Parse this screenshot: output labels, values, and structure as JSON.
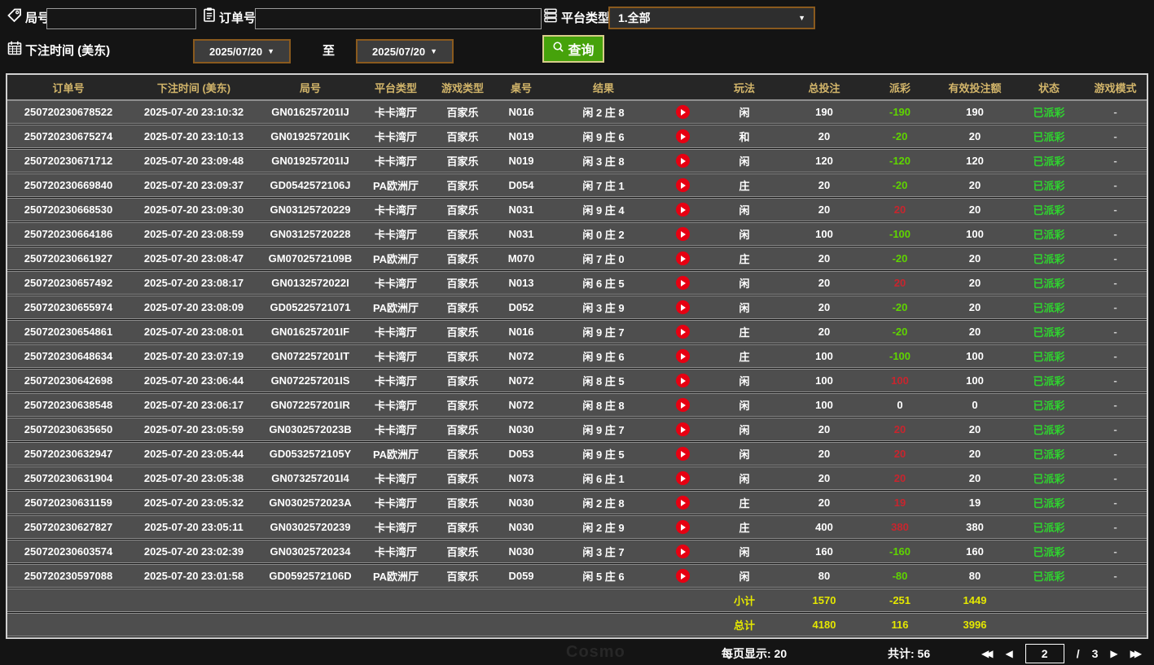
{
  "filter_bar": {
    "game_no_label": "局号",
    "game_no_value": "",
    "order_no_label": "订单号",
    "order_no_value": "",
    "platform_label": "平台类型",
    "platform_value": "1.全部",
    "bet_time_label": "下注时间 (美东)",
    "date_from": "2025/07/20",
    "range_to_label": "至",
    "date_to": "2025/07/20",
    "search_label": "查询"
  },
  "table": {
    "headers": [
      "订单号",
      "下注时间 (美东)",
      "局号",
      "平台类型",
      "游戏类型",
      "桌号",
      "结果",
      "",
      "玩法",
      "总投注",
      "派彩",
      "有效投注额",
      "状态",
      "游戏模式"
    ],
    "rows": [
      {
        "order_id": "250720230678522",
        "bet_time": "2025-07-20 23:10:32",
        "game_id": "GN016257201IJ",
        "platform": "卡卡湾厅",
        "game_type": "百家乐",
        "table_no": "N016",
        "result": "闲 2 庄 8",
        "play": "闲",
        "total_bet": "190",
        "payout": "-190",
        "valid_bet": "190",
        "status": "已派彩",
        "mode": "-"
      },
      {
        "order_id": "250720230675274",
        "bet_time": "2025-07-20 23:10:13",
        "game_id": "GN019257201IK",
        "platform": "卡卡湾厅",
        "game_type": "百家乐",
        "table_no": "N019",
        "result": "闲 9 庄 6",
        "play": "和",
        "total_bet": "20",
        "payout": "-20",
        "valid_bet": "20",
        "status": "已派彩",
        "mode": "-"
      },
      {
        "order_id": "250720230671712",
        "bet_time": "2025-07-20 23:09:48",
        "game_id": "GN019257201IJ",
        "platform": "卡卡湾厅",
        "game_type": "百家乐",
        "table_no": "N019",
        "result": "闲 3 庄 8",
        "play": "闲",
        "total_bet": "120",
        "payout": "-120",
        "valid_bet": "120",
        "status": "已派彩",
        "mode": "-"
      },
      {
        "order_id": "250720230669840",
        "bet_time": "2025-07-20 23:09:37",
        "game_id": "GD0542572106J",
        "platform": "PA欧洲厅",
        "game_type": "百家乐",
        "table_no": "D054",
        "result": "闲 7 庄 1",
        "play": "庄",
        "total_bet": "20",
        "payout": "-20",
        "valid_bet": "20",
        "status": "已派彩",
        "mode": "-"
      },
      {
        "order_id": "250720230668530",
        "bet_time": "2025-07-20 23:09:30",
        "game_id": "GN03125720229",
        "platform": "卡卡湾厅",
        "game_type": "百家乐",
        "table_no": "N031",
        "result": "闲 9 庄 4",
        "play": "闲",
        "total_bet": "20",
        "payout": "20",
        "valid_bet": "20",
        "status": "已派彩",
        "mode": "-"
      },
      {
        "order_id": "250720230664186",
        "bet_time": "2025-07-20 23:08:59",
        "game_id": "GN03125720228",
        "platform": "卡卡湾厅",
        "game_type": "百家乐",
        "table_no": "N031",
        "result": "闲 0 庄 2",
        "play": "闲",
        "total_bet": "100",
        "payout": "-100",
        "valid_bet": "100",
        "status": "已派彩",
        "mode": "-"
      },
      {
        "order_id": "250720230661927",
        "bet_time": "2025-07-20 23:08:47",
        "game_id": "GM0702572109B",
        "platform": "PA欧洲厅",
        "game_type": "百家乐",
        "table_no": "M070",
        "result": "闲 7 庄 0",
        "play": "庄",
        "total_bet": "20",
        "payout": "-20",
        "valid_bet": "20",
        "status": "已派彩",
        "mode": "-"
      },
      {
        "order_id": "250720230657492",
        "bet_time": "2025-07-20 23:08:17",
        "game_id": "GN0132572022I",
        "platform": "卡卡湾厅",
        "game_type": "百家乐",
        "table_no": "N013",
        "result": "闲 6 庄 5",
        "play": "闲",
        "total_bet": "20",
        "payout": "20",
        "valid_bet": "20",
        "status": "已派彩",
        "mode": "-"
      },
      {
        "order_id": "250720230655974",
        "bet_time": "2025-07-20 23:08:09",
        "game_id": "GD05225721071",
        "platform": "PA欧洲厅",
        "game_type": "百家乐",
        "table_no": "D052",
        "result": "闲 3 庄 9",
        "play": "闲",
        "total_bet": "20",
        "payout": "-20",
        "valid_bet": "20",
        "status": "已派彩",
        "mode": "-"
      },
      {
        "order_id": "250720230654861",
        "bet_time": "2025-07-20 23:08:01",
        "game_id": "GN016257201IF",
        "platform": "卡卡湾厅",
        "game_type": "百家乐",
        "table_no": "N016",
        "result": "闲 9 庄 7",
        "play": "庄",
        "total_bet": "20",
        "payout": "-20",
        "valid_bet": "20",
        "status": "已派彩",
        "mode": "-"
      },
      {
        "order_id": "250720230648634",
        "bet_time": "2025-07-20 23:07:19",
        "game_id": "GN072257201IT",
        "platform": "卡卡湾厅",
        "game_type": "百家乐",
        "table_no": "N072",
        "result": "闲 9 庄 6",
        "play": "庄",
        "total_bet": "100",
        "payout": "-100",
        "valid_bet": "100",
        "status": "已派彩",
        "mode": "-"
      },
      {
        "order_id": "250720230642698",
        "bet_time": "2025-07-20 23:06:44",
        "game_id": "GN072257201IS",
        "platform": "卡卡湾厅",
        "game_type": "百家乐",
        "table_no": "N072",
        "result": "闲 8 庄 5",
        "play": "闲",
        "total_bet": "100",
        "payout": "100",
        "valid_bet": "100",
        "status": "已派彩",
        "mode": "-"
      },
      {
        "order_id": "250720230638548",
        "bet_time": "2025-07-20 23:06:17",
        "game_id": "GN072257201IR",
        "platform": "卡卡湾厅",
        "game_type": "百家乐",
        "table_no": "N072",
        "result": "闲 8 庄 8",
        "play": "闲",
        "total_bet": "100",
        "payout": "0",
        "valid_bet": "0",
        "status": "已派彩",
        "mode": "-"
      },
      {
        "order_id": "250720230635650",
        "bet_time": "2025-07-20 23:05:59",
        "game_id": "GN0302572023B",
        "platform": "卡卡湾厅",
        "game_type": "百家乐",
        "table_no": "N030",
        "result": "闲 9 庄 7",
        "play": "闲",
        "total_bet": "20",
        "payout": "20",
        "valid_bet": "20",
        "status": "已派彩",
        "mode": "-"
      },
      {
        "order_id": "250720230632947",
        "bet_time": "2025-07-20 23:05:44",
        "game_id": "GD0532572105Y",
        "platform": "PA欧洲厅",
        "game_type": "百家乐",
        "table_no": "D053",
        "result": "闲 9 庄 5",
        "play": "闲",
        "total_bet": "20",
        "payout": "20",
        "valid_bet": "20",
        "status": "已派彩",
        "mode": "-"
      },
      {
        "order_id": "250720230631904",
        "bet_time": "2025-07-20 23:05:38",
        "game_id": "GN073257201I4",
        "platform": "卡卡湾厅",
        "game_type": "百家乐",
        "table_no": "N073",
        "result": "闲 6 庄 1",
        "play": "闲",
        "total_bet": "20",
        "payout": "20",
        "valid_bet": "20",
        "status": "已派彩",
        "mode": "-"
      },
      {
        "order_id": "250720230631159",
        "bet_time": "2025-07-20 23:05:32",
        "game_id": "GN0302572023A",
        "platform": "卡卡湾厅",
        "game_type": "百家乐",
        "table_no": "N030",
        "result": "闲 2 庄 8",
        "play": "庄",
        "total_bet": "20",
        "payout": "19",
        "valid_bet": "19",
        "status": "已派彩",
        "mode": "-"
      },
      {
        "order_id": "250720230627827",
        "bet_time": "2025-07-20 23:05:11",
        "game_id": "GN03025720239",
        "platform": "卡卡湾厅",
        "game_type": "百家乐",
        "table_no": "N030",
        "result": "闲 2 庄 9",
        "play": "庄",
        "total_bet": "400",
        "payout": "380",
        "valid_bet": "380",
        "status": "已派彩",
        "mode": "-"
      },
      {
        "order_id": "250720230603574",
        "bet_time": "2025-07-20 23:02:39",
        "game_id": "GN03025720234",
        "platform": "卡卡湾厅",
        "game_type": "百家乐",
        "table_no": "N030",
        "result": "闲 3 庄 7",
        "play": "闲",
        "total_bet": "160",
        "payout": "-160",
        "valid_bet": "160",
        "status": "已派彩",
        "mode": "-"
      },
      {
        "order_id": "250720230597088",
        "bet_time": "2025-07-20 23:01:58",
        "game_id": "GD0592572106D",
        "platform": "PA欧洲厅",
        "game_type": "百家乐",
        "table_no": "D059",
        "result": "闲 5 庄 6",
        "play": "闲",
        "total_bet": "80",
        "payout": "-80",
        "valid_bet": "80",
        "status": "已派彩",
        "mode": "-"
      }
    ],
    "subtotal": {
      "label": "小计",
      "total_bet": "1570",
      "payout": "-251",
      "valid_bet": "1449"
    },
    "grand_total": {
      "label": "总计",
      "total_bet": "4180",
      "payout": "116",
      "valid_bet": "3996"
    }
  },
  "footer": {
    "per_page_text": "每页显示: 20",
    "total_count_text": "共计: 56",
    "current_page": "2",
    "page_separator": "/",
    "total_pages": "3"
  },
  "watermark_text": "Cosmo",
  "colors": {
    "payout_negative_green": "#5fd400",
    "payout_positive_red": "#c8252e",
    "status_paid_green": "#2fd32f",
    "summary_yellow": "#e5e800",
    "header_gold": "#d2b56a",
    "search_button_green": "#46a20b",
    "picker_border_orange": "#8a5a1e"
  }
}
